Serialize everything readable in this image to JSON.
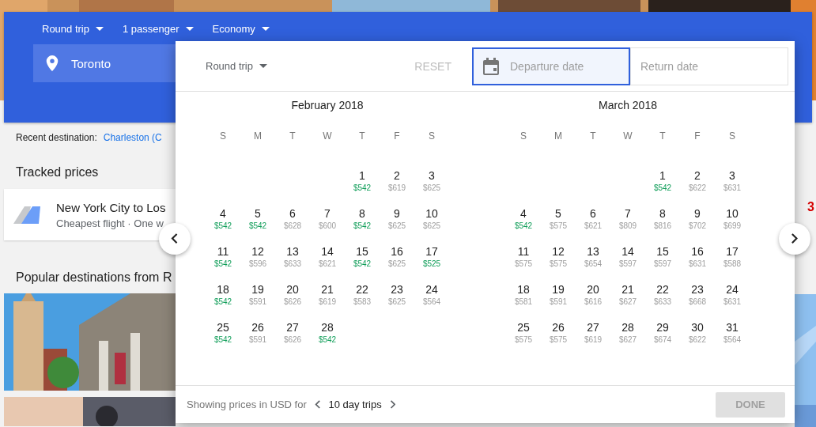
{
  "header": {
    "options": [
      {
        "label": "Round trip"
      },
      {
        "label": "1 passenger"
      },
      {
        "label": "Economy"
      }
    ],
    "origin": {
      "value": "Toronto"
    }
  },
  "recent": {
    "label": "Recent destination:",
    "link": "Charleston (C"
  },
  "tracked": {
    "title": "Tracked prices",
    "card": {
      "title": "New York City to Los",
      "subtitle": "Cheapest flight · One w",
      "price_fragment": "3"
    }
  },
  "popular": {
    "title": "Popular destinations from R"
  },
  "dialog": {
    "trip_type": "Round trip",
    "reset": {
      "label": "RESET",
      "disabled": true
    },
    "departure": {
      "placeholder": "Departure date",
      "focused": true
    },
    "return": {
      "placeholder": "Return date",
      "focused": false
    },
    "months": [
      {
        "title": "February 2018",
        "weekdays": [
          "S",
          "M",
          "T",
          "W",
          "T",
          "F",
          "S"
        ],
        "weeks": [
          [
            {
              "day": "1",
              "price": "$542",
              "cheap": true
            },
            {
              "day": "2",
              "price": "$619",
              "cheap": false
            },
            {
              "day": "3",
              "price": "$625",
              "cheap": false
            }
          ],
          [
            {
              "day": "4",
              "price": "$542",
              "cheap": true
            },
            {
              "day": "5",
              "price": "$542",
              "cheap": true
            },
            {
              "day": "6",
              "price": "$628",
              "cheap": false
            },
            {
              "day": "7",
              "price": "$600",
              "cheap": false
            },
            {
              "day": "8",
              "price": "$542",
              "cheap": true
            },
            {
              "day": "9",
              "price": "$625",
              "cheap": false
            },
            {
              "day": "10",
              "price": "$625",
              "cheap": false
            }
          ],
          [
            {
              "day": "11",
              "price": "$542",
              "cheap": true
            },
            {
              "day": "12",
              "price": "$596",
              "cheap": false
            },
            {
              "day": "13",
              "price": "$633",
              "cheap": false
            },
            {
              "day": "14",
              "price": "$621",
              "cheap": false
            },
            {
              "day": "15",
              "price": "$542",
              "cheap": true
            },
            {
              "day": "16",
              "price": "$625",
              "cheap": false
            },
            {
              "day": "17",
              "price": "$525",
              "cheap": true
            }
          ],
          [
            {
              "day": "18",
              "price": "$542",
              "cheap": true
            },
            {
              "day": "19",
              "price": "$591",
              "cheap": false
            },
            {
              "day": "20",
              "price": "$626",
              "cheap": false
            },
            {
              "day": "21",
              "price": "$619",
              "cheap": false
            },
            {
              "day": "22",
              "price": "$583",
              "cheap": false
            },
            {
              "day": "23",
              "price": "$625",
              "cheap": false
            },
            {
              "day": "24",
              "price": "$564",
              "cheap": false
            }
          ],
          [
            {
              "day": "25",
              "price": "$542",
              "cheap": true
            },
            {
              "day": "26",
              "price": "$591",
              "cheap": false
            },
            {
              "day": "27",
              "price": "$626",
              "cheap": false
            },
            {
              "day": "28",
              "price": "$542",
              "cheap": true
            }
          ]
        ]
      },
      {
        "title": "March 2018",
        "weekdays": [
          "S",
          "M",
          "T",
          "W",
          "T",
          "F",
          "S"
        ],
        "weeks": [
          [
            {
              "day": "1",
              "price": "$542",
              "cheap": true
            },
            {
              "day": "2",
              "price": "$622",
              "cheap": false
            },
            {
              "day": "3",
              "price": "$631",
              "cheap": false
            }
          ],
          [
            {
              "day": "4",
              "price": "$542",
              "cheap": true
            },
            {
              "day": "5",
              "price": "$575",
              "cheap": false
            },
            {
              "day": "6",
              "price": "$621",
              "cheap": false
            },
            {
              "day": "7",
              "price": "$809",
              "cheap": false
            },
            {
              "day": "8",
              "price": "$816",
              "cheap": false
            },
            {
              "day": "9",
              "price": "$702",
              "cheap": false
            },
            {
              "day": "10",
              "price": "$699",
              "cheap": false
            }
          ],
          [
            {
              "day": "11",
              "price": "$575",
              "cheap": false
            },
            {
              "day": "12",
              "price": "$575",
              "cheap": false
            },
            {
              "day": "13",
              "price": "$654",
              "cheap": false
            },
            {
              "day": "14",
              "price": "$597",
              "cheap": false
            },
            {
              "day": "15",
              "price": "$597",
              "cheap": false
            },
            {
              "day": "16",
              "price": "$631",
              "cheap": false
            },
            {
              "day": "17",
              "price": "$588",
              "cheap": false
            }
          ],
          [
            {
              "day": "18",
              "price": "$581",
              "cheap": false
            },
            {
              "day": "19",
              "price": "$591",
              "cheap": false
            },
            {
              "day": "20",
              "price": "$616",
              "cheap": false
            },
            {
              "day": "21",
              "price": "$627",
              "cheap": false
            },
            {
              "day": "22",
              "price": "$633",
              "cheap": false
            },
            {
              "day": "23",
              "price": "$668",
              "cheap": false
            },
            {
              "day": "24",
              "price": "$631",
              "cheap": false
            }
          ],
          [
            {
              "day": "25",
              "price": "$575",
              "cheap": false
            },
            {
              "day": "26",
              "price": "$575",
              "cheap": false
            },
            {
              "day": "27",
              "price": "$619",
              "cheap": false
            },
            {
              "day": "28",
              "price": "$627",
              "cheap": false
            },
            {
              "day": "29",
              "price": "$674",
              "cheap": false
            },
            {
              "day": "30",
              "price": "$622",
              "cheap": false
            },
            {
              "day": "31",
              "price": "$564",
              "cheap": false
            }
          ]
        ]
      }
    ],
    "footer": {
      "label": "Showing prices in USD for",
      "duration": "10 day trips",
      "done": {
        "label": "DONE",
        "disabled": true
      }
    }
  }
}
